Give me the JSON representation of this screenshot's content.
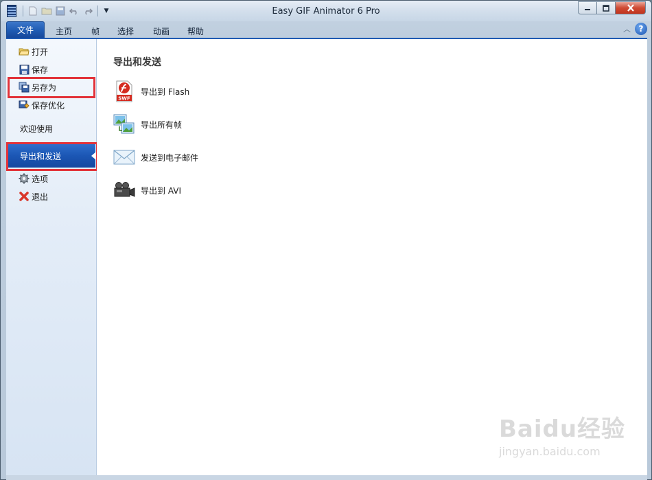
{
  "window": {
    "title": "Easy GIF Animator 6 Pro"
  },
  "ribbon": {
    "tabs": [
      {
        "label": "文件"
      },
      {
        "label": "主页"
      },
      {
        "label": "帧"
      },
      {
        "label": "选择"
      },
      {
        "label": "动画"
      },
      {
        "label": "帮助"
      }
    ],
    "help_label": "?"
  },
  "sidebar": {
    "items": [
      {
        "label": "打开",
        "icon": "folder-open-icon"
      },
      {
        "label": "保存",
        "icon": "floppy-disk-icon"
      },
      {
        "label": "另存为",
        "icon": "save-as-icon"
      },
      {
        "label": "保存优化",
        "icon": "save-optimized-icon"
      },
      {
        "label": "欢迎使用"
      },
      {
        "label": "导出和发送"
      },
      {
        "label": "选项",
        "icon": "gear-icon"
      },
      {
        "label": "退出",
        "icon": "red-x-icon"
      }
    ],
    "selected": "导出和发送"
  },
  "content": {
    "title": "导出和发送",
    "actions": [
      {
        "label": "导出到 Flash",
        "icon": "swf-flash-icon",
        "icon_text": "SWF"
      },
      {
        "label": "导出所有帧",
        "icon": "frames-images-icon"
      },
      {
        "label": "发送到电子邮件",
        "icon": "envelope-icon"
      },
      {
        "label": "导出到 AVI",
        "icon": "video-camera-icon"
      }
    ]
  },
  "watermark": {
    "brand": "Baidu经验",
    "url": "jingyan.baidu.com"
  },
  "colors": {
    "accent": "#1f5bb3",
    "highlight_box": "#e2333a",
    "close_button": "#c0341e"
  }
}
